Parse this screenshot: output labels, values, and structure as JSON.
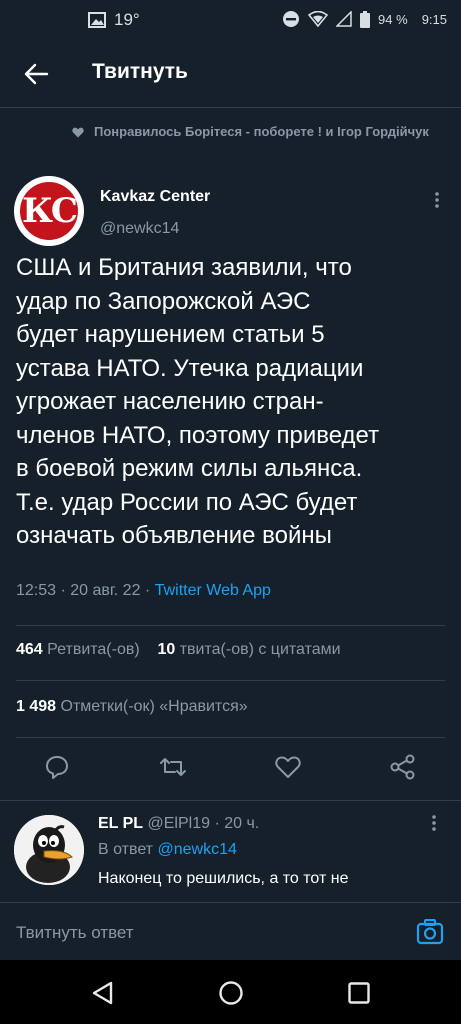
{
  "status_bar": {
    "temperature": "19°",
    "battery": "94 %",
    "time": "9:15",
    "icons": [
      "image-icon",
      "dnd-icon",
      "wifi-icon",
      "signal-icon",
      "battery-icon"
    ]
  },
  "app_bar": {
    "title": "Твитнуть",
    "back_icon": "arrow-left-icon"
  },
  "social_context": {
    "text": "Понравилось Борітеся - поборете ! и Ігор Гордійчук",
    "icon": "heart-icon"
  },
  "tweet": {
    "author_name": "Kavkaz Center",
    "author_handle": "@newkc14",
    "avatar_text": "КС",
    "body_lines": [
      "США и Британия заявили, что",
      "удар по Запорожской АЭС",
      "будет нарушением статьи 5",
      "устава НАТО. Утечка радиации",
      "угрожает населению стран-",
      "членов НАТО, поэтому приведет",
      "в боевой режим силы альянса.",
      "Т.е. удар России по АЭС будет",
      "означать объявление войны"
    ],
    "timestamp": "12:53 · 20 авг. 22 · ",
    "source": "Twitter Web App",
    "retweets_count": "464",
    "retweets_label": "Ретвита(-ов)",
    "quotes_count": "10",
    "quotes_label": "твита(-ов) с цитатами",
    "likes_count": "1 498",
    "likes_label": "Отметки(-ок) «Нравится»",
    "actions": [
      "reply-icon",
      "retweet-icon",
      "like-icon",
      "share-icon"
    ]
  },
  "reply": {
    "name": "EL PL",
    "meta": "@ElPl19 · 20 ч.",
    "reply_to_label": "В ответ",
    "reply_to_handle": "@newkc14",
    "text": "Наконец то решились, а то тот не"
  },
  "compose": {
    "placeholder": "Твитнуть ответ",
    "icon": "camera-icon"
  },
  "nav": [
    "back-triangle-icon",
    "home-circle-icon",
    "recents-square-icon"
  ],
  "colors": {
    "background": "#15202b",
    "accent": "#1da1f2",
    "secondary_text": "#8899a6",
    "divider": "#2f3d4b"
  }
}
